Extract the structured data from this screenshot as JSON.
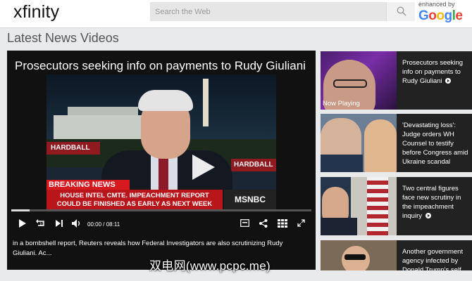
{
  "header": {
    "logo": "xfinity",
    "search_placeholder": "Search the Web",
    "enhanced_label": "enhanced by",
    "google_letters": [
      "G",
      "o",
      "o",
      "g",
      "l",
      "e"
    ]
  },
  "section_title": "Latest News Videos",
  "main_video": {
    "title": "Prosecutors seeking info on payments to Rudy Giuliani",
    "overlay": {
      "hardball_left": "HARDBALL",
      "hardball_right": "HARDBALL",
      "breaking": "BREAKING NEWS",
      "ticker_line1": "HOUSE INTEL CMTE. IMPEACHMENT REPORT",
      "ticker_line2": "COULD BE FINISHED AS EARLY AS NEXT WEEK",
      "network": "MSNBC"
    },
    "progress_fraction": 0.06,
    "current_time": "00:00",
    "duration": "08:11",
    "description": "in a bombshell report, Reuters reveals how Federal Investigators are also scrutinizing Rudy Giuliani. Ac..."
  },
  "sidebar": {
    "items": [
      {
        "title": "Prosecutors seeking info on payments to Rudy Giuliani",
        "badge": "Now Playing"
      },
      {
        "title": "'Devastating loss': Judge orders WH Counsel to testify before Congress amid Ukraine scandal"
      },
      {
        "title": "Two central figures face new scrutiny in the impeachment inquiry"
      },
      {
        "title": "Another government agency infected by Donald Trump's self"
      }
    ]
  },
  "watermark": "双电网(www.pcpc.me)"
}
